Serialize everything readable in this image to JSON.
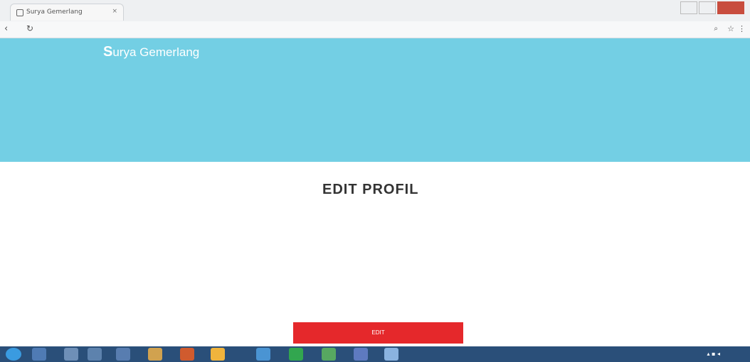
{
  "browser": {
    "tab_title": "Surya Gemerlang",
    "tab_close": "×",
    "window_title": "",
    "url": "",
    "icons": {
      "back": "back-arrow",
      "refresh": "refresh",
      "zoom": "zoom",
      "star": "star",
      "menu": "menu"
    }
  },
  "site": {
    "brand": "Surya Gemerlang",
    "brand_first": "S",
    "brand_rest": "urya Gemerlang",
    "tagline": "",
    "top_links": [
      "",
      ""
    ],
    "nav": [
      "",
      "",
      "",
      "",
      ""
    ]
  },
  "page": {
    "title": "EDIT PROFIL",
    "fields": [
      {
        "label": "",
        "value": ""
      },
      {
        "label": "",
        "value": ""
      },
      {
        "label": "",
        "value": ""
      }
    ],
    "button": "EDIT"
  },
  "colors": {
    "header": "#73cfe4",
    "button": "#e5282b",
    "taskbar": "#2a4f79"
  },
  "taskbar": {
    "start": "windows-start",
    "clock": ""
  }
}
